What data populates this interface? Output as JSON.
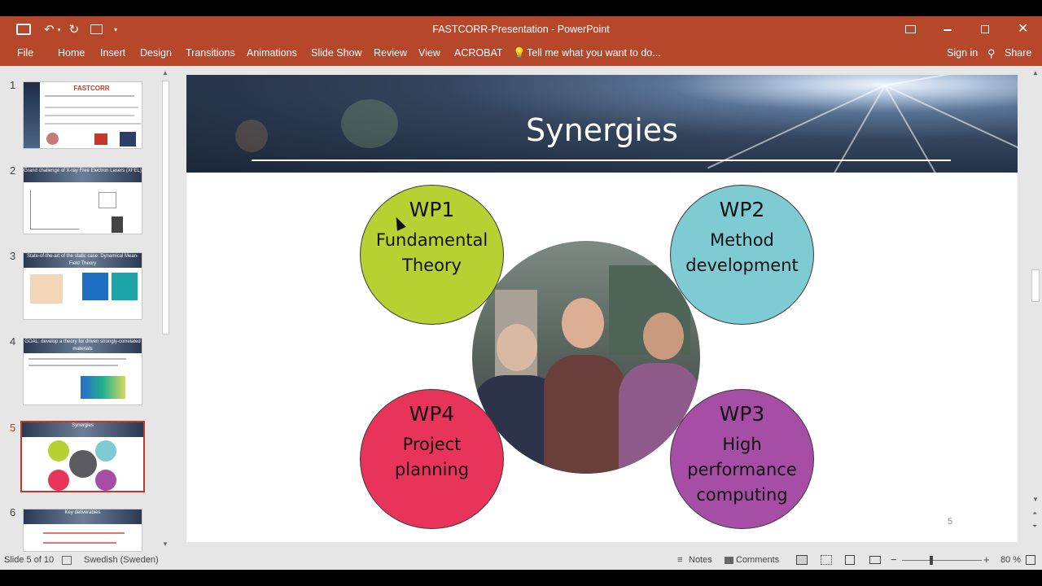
{
  "window": {
    "title": "FASTCORR-Presentation - PowerPoint",
    "sign_in": "Sign in",
    "share": "Share"
  },
  "colors": {
    "accent": "#b7472a",
    "wp1": "#b7d132",
    "wp2": "#7ecbd3",
    "wp3": "#a64ea6",
    "wp4": "#e8345a"
  },
  "ribbon": {
    "tabs": [
      "File",
      "Home",
      "Insert",
      "Design",
      "Transitions",
      "Animations",
      "Slide Show",
      "Review",
      "View",
      "ACROBAT"
    ],
    "tell_me": "Tell me what you want to do..."
  },
  "thumbnails": [
    {
      "number": "1",
      "title": "FASTCORR"
    },
    {
      "number": "2",
      "title": "Grand challenge of X-ray Free Electron Lasers (XFEL)"
    },
    {
      "number": "3",
      "title": "State-of-the-art of the static case: Dynamical Mean-Field Theory"
    },
    {
      "number": "4",
      "title": "GOAL: develop a theory for driven strongly-correlated materials"
    },
    {
      "number": "5",
      "title": "Synergies"
    },
    {
      "number": "6",
      "title": "Key deliverables"
    }
  ],
  "slide": {
    "title": "Synergies",
    "number": "5",
    "packages": {
      "wp1": {
        "title": "WP1",
        "lines": [
          "Fundamental",
          "Theory"
        ]
      },
      "wp2": {
        "title": "WP2",
        "lines": [
          "Method",
          "development"
        ]
      },
      "wp3": {
        "title": "WP3",
        "lines": [
          "High",
          "performance",
          "computing"
        ]
      },
      "wp4": {
        "title": "WP4",
        "lines": [
          "Project",
          "planning"
        ]
      }
    }
  },
  "status": {
    "slide_of": "Slide 5 of 10",
    "language": "Swedish (Sweden)",
    "notes": "Notes",
    "comments": "Comments",
    "zoom": "80 %"
  },
  "icons": [
    "save-icon",
    "undo-icon",
    "redo-icon",
    "present-icon",
    "lightbulb-icon",
    "person-icon",
    "notes-icon",
    "comments-icon",
    "normal-view-icon",
    "slide-sorter-icon",
    "reading-view-icon",
    "slideshow-icon"
  ]
}
